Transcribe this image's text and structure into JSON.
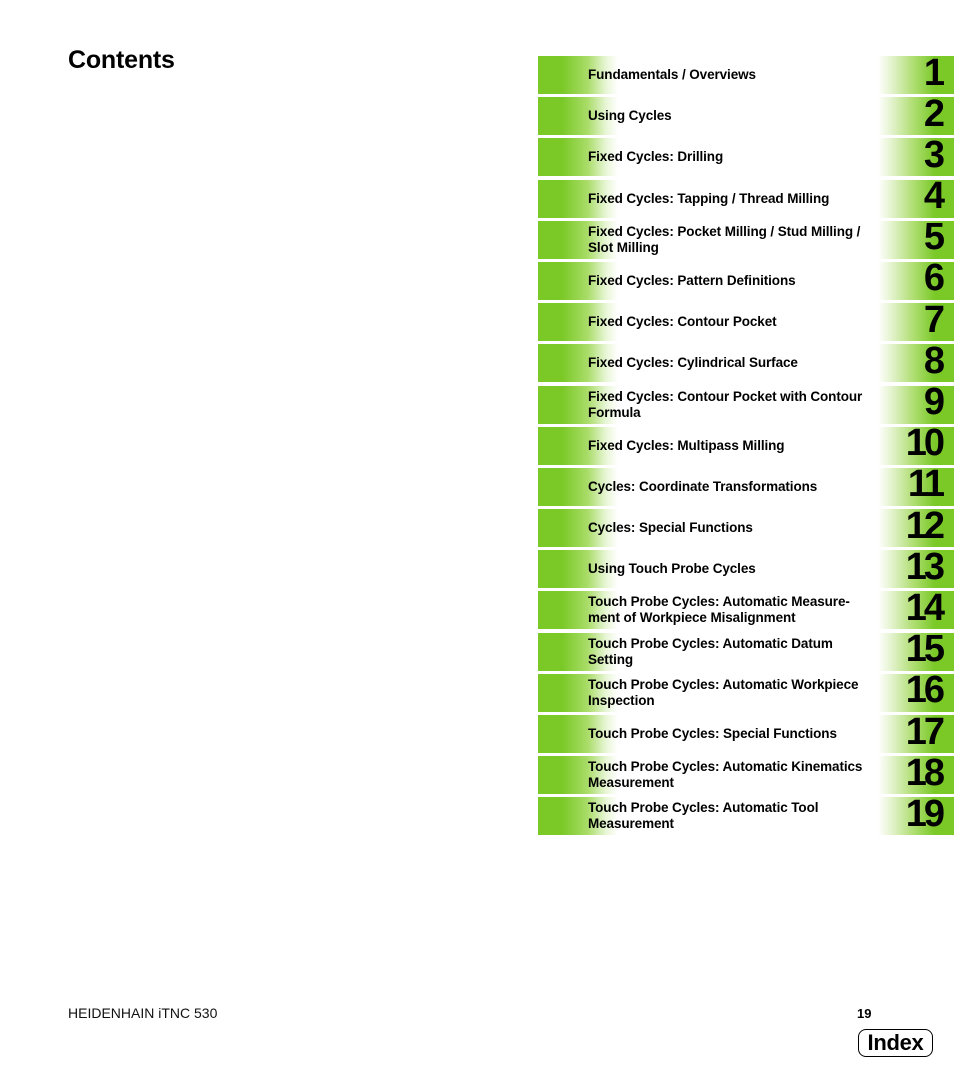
{
  "page": {
    "title": "Contents"
  },
  "colors": {
    "accent_green": "#7ac927",
    "text": "#000000",
    "background": "#ffffff"
  },
  "toc": {
    "items": [
      {
        "number": "1",
        "label": "Fundamentals / Overviews"
      },
      {
        "number": "2",
        "label": "Using Cycles"
      },
      {
        "number": "3",
        "label": "Fixed Cycles: Drilling"
      },
      {
        "number": "4",
        "label": "Fixed Cycles: Tapping / Thread Milling"
      },
      {
        "number": "5",
        "label": "Fixed Cycles: Pocket Milling / Stud Milling / Slot Milling"
      },
      {
        "number": "6",
        "label": "Fixed Cycles: Pattern Definitions"
      },
      {
        "number": "7",
        "label": "Fixed Cycles: Contour Pocket"
      },
      {
        "number": "8",
        "label": "Fixed Cycles: Cylindrical Surface"
      },
      {
        "number": "9",
        "label": "Fixed Cycles: Contour Pocket with Contour Formula"
      },
      {
        "number": "10",
        "label": "Fixed Cycles: Multipass Milling"
      },
      {
        "number": "11",
        "label": "Cycles: Coordinate Transformations"
      },
      {
        "number": "12",
        "label": "Cycles: Special Functions"
      },
      {
        "number": "13",
        "label": "Using Touch Probe Cycles"
      },
      {
        "number": "14",
        "label": "Touch Probe Cycles: Automatic Measure-ment of Workpiece Misalignment"
      },
      {
        "number": "15",
        "label": "Touch Probe Cycles: Automatic Datum Setting"
      },
      {
        "number": "16",
        "label": "Touch Probe Cycles: Automatic Workpiece Inspection"
      },
      {
        "number": "17",
        "label": "Touch Probe Cycles: Special Functions"
      },
      {
        "number": "18",
        "label": "Touch Probe Cycles: Automatic Kinematics Measurement"
      },
      {
        "number": "19",
        "label": "Touch Probe Cycles: Automatic Tool Measurement"
      }
    ]
  },
  "footer": {
    "product": "HEIDENHAIN iTNC 530",
    "page_number": "19",
    "index_label": "Index"
  }
}
